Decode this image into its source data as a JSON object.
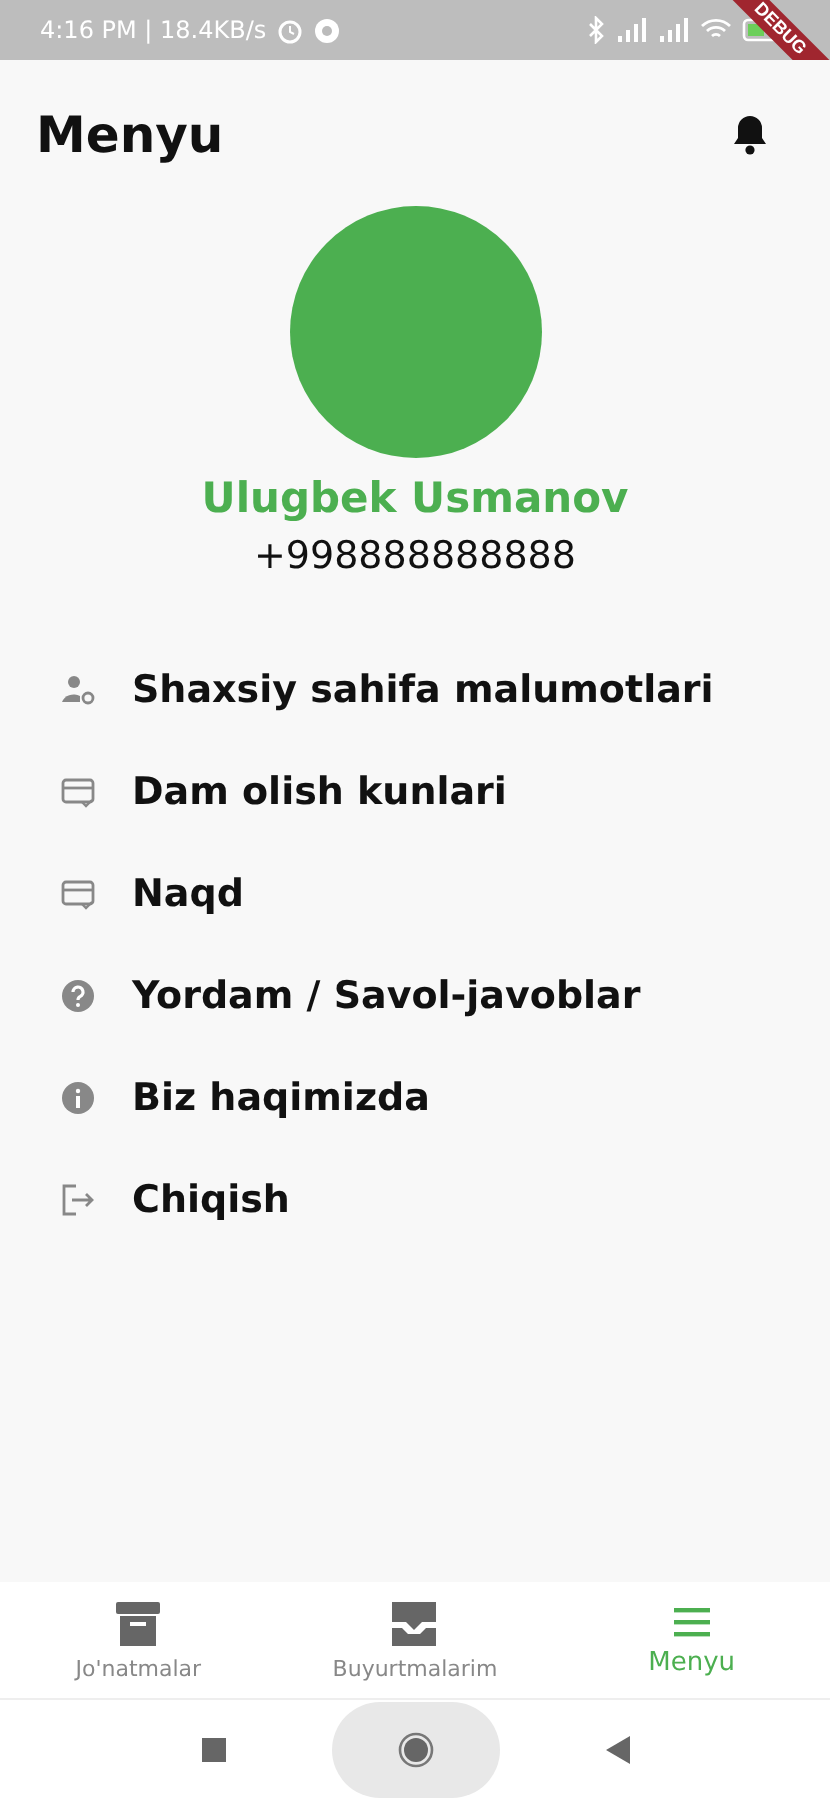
{
  "status_bar": {
    "left_text": "4:16 PM | 18.4KB/s",
    "banner": "DEBUG"
  },
  "header": {
    "title": "Menyu"
  },
  "profile": {
    "name": "Ulugbek Usmanov",
    "phone": "+998888888888"
  },
  "menu_items": [
    {
      "kind": "profile",
      "label": "Shaxsiy sahifa malumotlari"
    },
    {
      "kind": "card",
      "label": "Dam olish kunlari"
    },
    {
      "kind": "card",
      "label": "Naqd"
    },
    {
      "kind": "help",
      "label": "Yordam / Savol-javoblar"
    },
    {
      "kind": "info",
      "label": "Biz haqimizda"
    },
    {
      "kind": "logout",
      "label": "Chiqish"
    }
  ],
  "bottom_nav": [
    {
      "kind": "archive",
      "label": "Jo'natmalar",
      "selected": false
    },
    {
      "kind": "inbox",
      "label": "Buyurtmalarim",
      "selected": false
    },
    {
      "kind": "menu",
      "label": "Menyu",
      "selected": true
    }
  ]
}
